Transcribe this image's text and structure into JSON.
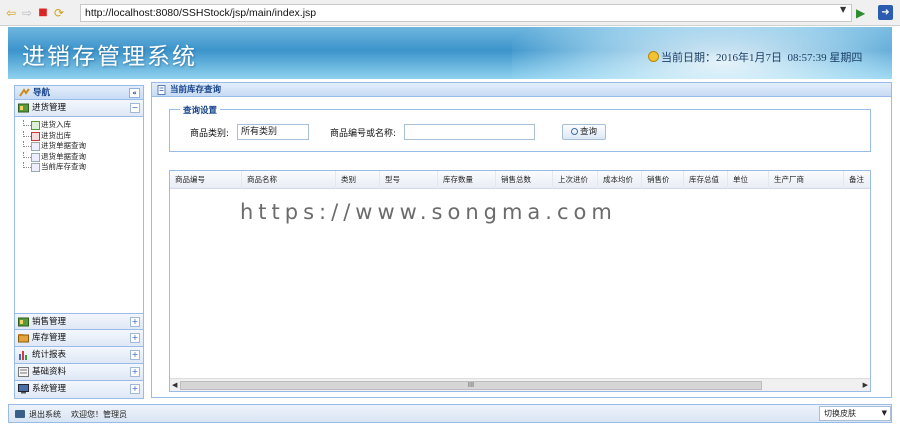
{
  "browser": {
    "url": "http://localhost:8080/SSHStock/jsp/main/index.jsp"
  },
  "header": {
    "app_title": "进销存管理系统",
    "date_label": "当前日期：",
    "date_value": "2016年1月7日",
    "time_value": "08:57:39 星期四"
  },
  "nav": {
    "title": "导航",
    "collapse_glyph": "«",
    "active_group": {
      "label": "进货管理",
      "toggle": "−",
      "items": [
        {
          "label": "进货入库"
        },
        {
          "label": "进货出库"
        },
        {
          "label": "进货单据查询"
        },
        {
          "label": "退货单据查询"
        },
        {
          "label": "当前库存查询"
        }
      ]
    },
    "groups": [
      {
        "label": "销售管理",
        "toggle": "+"
      },
      {
        "label": "库存管理",
        "toggle": "+"
      },
      {
        "label": "统计报表",
        "toggle": "+"
      },
      {
        "label": "基础资料",
        "toggle": "+"
      },
      {
        "label": "系统管理",
        "toggle": "+"
      }
    ]
  },
  "main": {
    "title": "当前库存查询",
    "query": {
      "legend": "查询设置",
      "category_label": "商品类别:",
      "category_value": "所有类别",
      "keyword_label": "商品编号或名称:",
      "keyword_value": "",
      "button_label": "查询"
    },
    "table": {
      "columns": [
        "商品编号",
        "商品名称",
        "类别",
        "型号",
        "库存数量",
        "销售总数",
        "上次进价",
        "成本均价",
        "销售价",
        "库存总值",
        "单位",
        "生产厂商",
        "备注"
      ],
      "scroll_thumb": "III"
    }
  },
  "watermark": "https://www.songma.com",
  "status": {
    "logout": "退出系统",
    "welcome": "欢迎您！管理员",
    "skin_select": "切换皮肤"
  }
}
